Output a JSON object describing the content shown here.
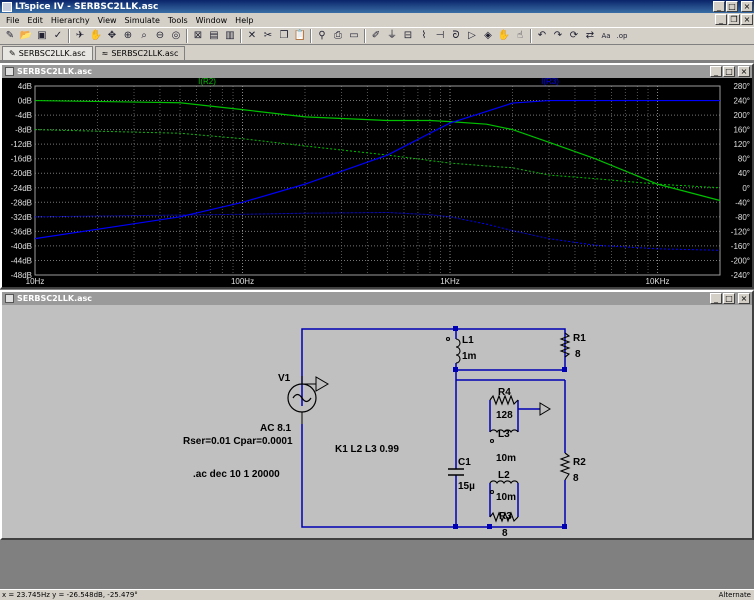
{
  "app": {
    "title": "LTspice IV - SERBSC2LLK.asc"
  },
  "menu": [
    "File",
    "Edit",
    "Hierarchy",
    "View",
    "Simulate",
    "Tools",
    "Window",
    "Help"
  ],
  "toolbar_icons": [
    "new-schematic-icon",
    "open-icon",
    "save-icon",
    "control-panel-icon",
    "run-icon",
    "halt-icon",
    "pan-icon",
    "zoom-in-icon",
    "zoom-area-icon",
    "zoom-out-icon",
    "zoom-fit-icon",
    "autorange-icon",
    "tile-horizontal-icon",
    "tile-vertical-icon",
    "close-window-icon",
    "cut-icon",
    "copy-icon",
    "paste-icon",
    "find-icon",
    "print-icon",
    "print-setup-icon",
    "wire-icon",
    "ground-icon",
    "label-icon",
    "resistor-icon",
    "capacitor-icon",
    "inductor-icon",
    "diode-icon",
    "component-icon",
    "move-icon",
    "drag-icon",
    "undo-icon",
    "redo-icon",
    "rotate-icon",
    "mirror-icon",
    "text-icon",
    "spice-directive-icon"
  ],
  "tabs": [
    {
      "label": "SERBSC2LLK.asc",
      "kind": "schematic"
    },
    {
      "label": "SERBSC2LLK.asc",
      "kind": "waveform"
    }
  ],
  "plot_window": {
    "title": "SERBSC2LLK.asc"
  },
  "schematic_window": {
    "title": "SERBSC2LLK.asc"
  },
  "status": {
    "readout": "x = 23.745Hz    y = -26.548dB, -25.479°",
    "mode": "Alternate"
  },
  "chart_data": {
    "type": "line",
    "x_scale": "log",
    "xlim": [
      10,
      20000
    ],
    "x_ticks": [
      "10Hz",
      "100Hz",
      "1KHz",
      "10KHz"
    ],
    "y_ticks_left": [
      "4dB",
      "0dB",
      "-4dB",
      "-8dB",
      "-12dB",
      "-16dB",
      "-20dB",
      "-24dB",
      "-28dB",
      "-32dB",
      "-36dB",
      "-40dB",
      "-44dB",
      "-48dB"
    ],
    "ylim_left": [
      -48,
      4
    ],
    "y_ticks_right": [
      "280°",
      "240°",
      "200°",
      "160°",
      "120°",
      "80°",
      "40°",
      "0°",
      "-40°",
      "-80°",
      "-120°",
      "-160°",
      "-200°",
      "-240°"
    ],
    "ylim_right": [
      -240,
      280
    ],
    "grid": true,
    "series": [
      {
        "name": "I(R2)",
        "color": "#00c000",
        "x": [
          10,
          50,
          100,
          200,
          500,
          800,
          1000,
          1500,
          2000,
          3000,
          5000,
          10000,
          20000
        ],
        "magnitude_db": [
          0,
          -0.6,
          -2.5,
          -4.5,
          -5.5,
          -5.5,
          -5.8,
          -6.5,
          -8,
          -11.5,
          -16,
          -23,
          -27.5
        ],
        "phase_deg": [
          160,
          150,
          135,
          115,
          90,
          75,
          68,
          60,
          55,
          35,
          25,
          10,
          0
        ]
      },
      {
        "name": "I(R3)",
        "color": "#0000ff",
        "x": [
          10,
          50,
          100,
          200,
          500,
          800,
          1000,
          1500,
          2000,
          3000,
          5000,
          10000,
          20000
        ],
        "magnitude_db": [
          -38,
          -32,
          -28,
          -23,
          -15,
          -9,
          -6.2,
          -3,
          -0.7,
          0,
          0,
          0,
          0
        ],
        "phase_deg": [
          -80,
          -75,
          -73,
          -70,
          -68,
          -74,
          -80,
          -100,
          -118,
          -140,
          -158,
          -168,
          -172
        ]
      }
    ]
  },
  "schematic": {
    "labels": {
      "v1": "V1",
      "ac": "AC 8.1",
      "vparams": "Rser=0.01 Cpar=0.0001",
      "ac_dir": ".ac dec 10 1 20000",
      "k_dir": "K1 L2 L3 0.99",
      "l1": "L1",
      "l1v": "1m",
      "r1": "R1",
      "r1v": "8",
      "r4": "R4",
      "r4v": "128",
      "l3": "L3",
      "l3v": "10m",
      "c1": "C1",
      "c1v": "15µ",
      "r2": "R2",
      "r2v": "8",
      "l2": "L2",
      "l2v": "10m",
      "r3": "R3",
      "r3v": "8"
    }
  }
}
